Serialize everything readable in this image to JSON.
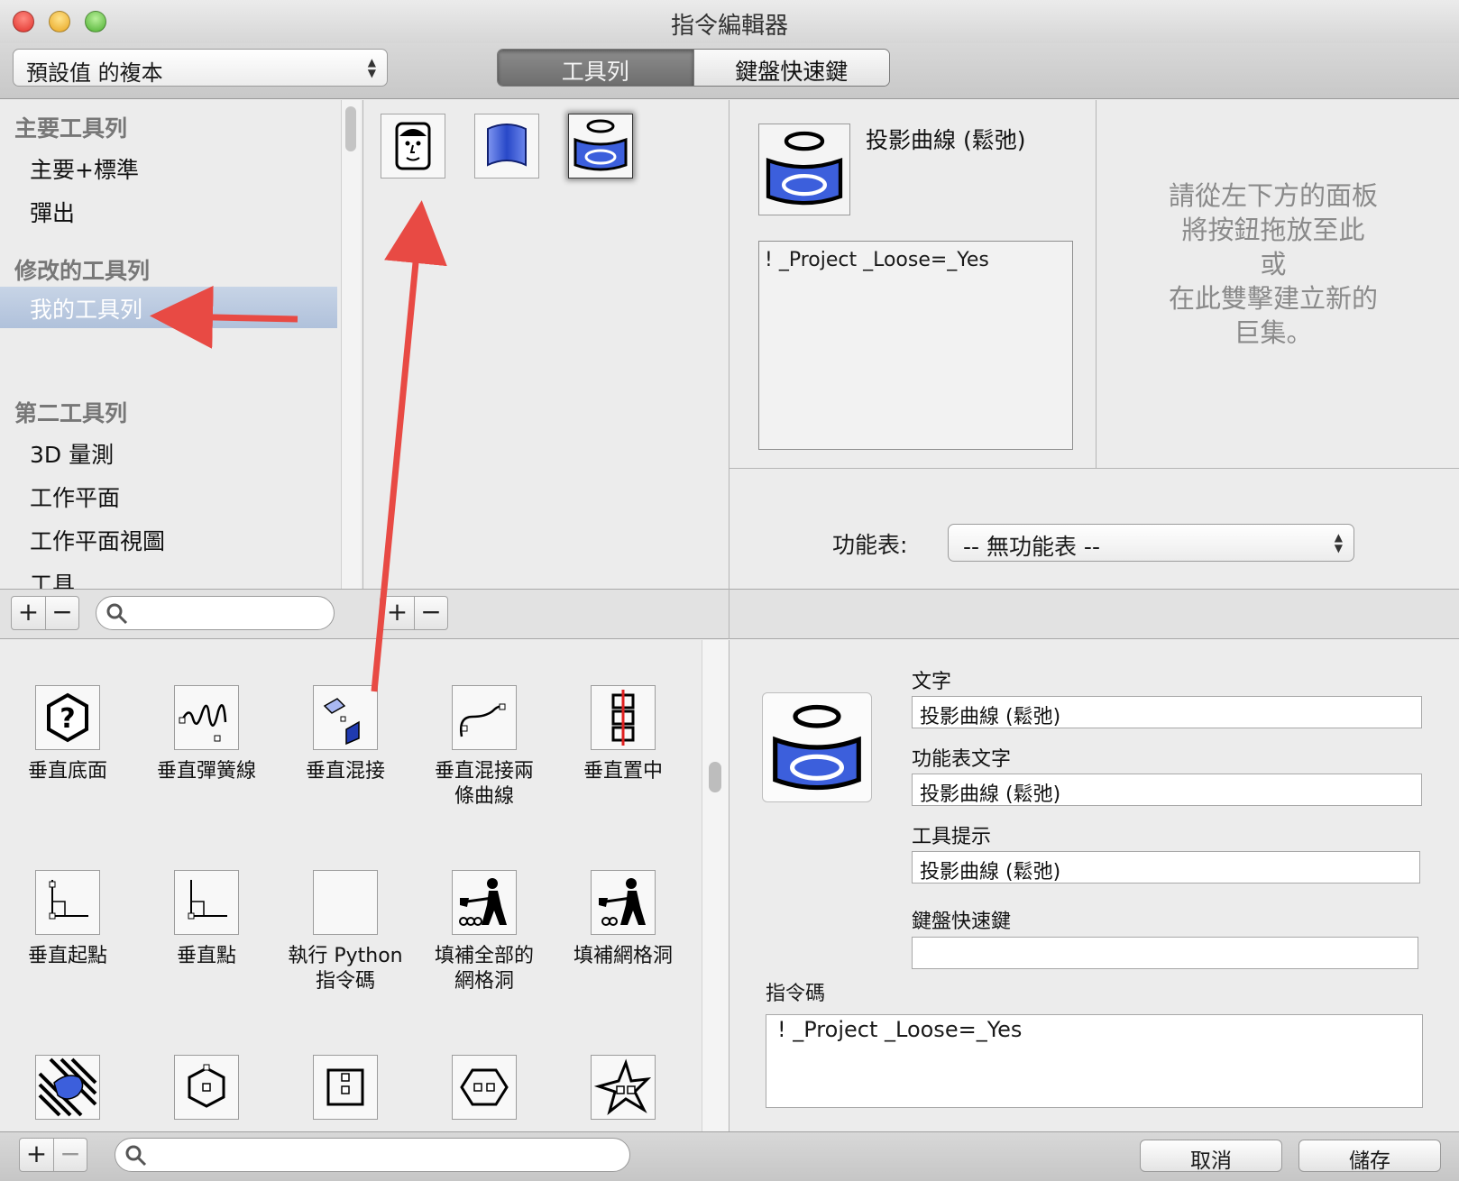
{
  "window": {
    "title": "指令編輯器"
  },
  "toolbar": {
    "preset_value": "預設值 的複本",
    "tabs": [
      {
        "label": "工具列",
        "active": true
      },
      {
        "label": "鍵盤快速鍵",
        "active": false
      }
    ]
  },
  "sidebar": {
    "groups": [
      {
        "label": "主要工具列",
        "items": [
          "主要+標準",
          "彈出"
        ]
      },
      {
        "label": "修改的工具列",
        "items": [
          "我的工具列"
        ]
      },
      {
        "label": "第二工具列",
        "items": [
          "3D 量測",
          "工作平面",
          "工作平面視圖",
          "工具"
        ]
      }
    ],
    "selected": "我的工具列"
  },
  "toolbar_buttons": [
    {
      "icon": "face-icon"
    },
    {
      "icon": "blue-surface-icon"
    },
    {
      "icon": "project-curve-icon",
      "selected": true
    }
  ],
  "properties": {
    "command_name": "投影曲線 (鬆弛)",
    "macro": "! _Project _Loose=_Yes",
    "hint_lines": [
      "請從左下方的面板",
      "將按鈕拖放至此",
      "或",
      "在此雙擊建立新的",
      "巨集。"
    ],
    "menu_label": "功能表:",
    "menu_value": "-- 無功能表 --"
  },
  "library": {
    "items": [
      {
        "label": "垂直底面",
        "icon": "hexagon-question-icon"
      },
      {
        "label": "垂直彈簧線",
        "icon": "spring-curve-icon"
      },
      {
        "label": "垂直混接",
        "icon": "blend-surface-icon"
      },
      {
        "label": "垂直混接兩\n條曲線",
        "icon": "blend-curves-icon"
      },
      {
        "label": "垂直置中",
        "icon": "center-align-icon"
      },
      {
        "label": "垂直起點",
        "icon": "perp-start-icon"
      },
      {
        "label": "垂直點",
        "icon": "perp-point-icon"
      },
      {
        "label": "執行 Python\n指令碼",
        "icon": "blank-icon"
      },
      {
        "label": "填補全部的\n網格洞",
        "icon": "shovel-man-all-icon"
      },
      {
        "label": "填補網格洞",
        "icon": "shovel-man-icon"
      },
      {
        "label": "",
        "icon": "hatched-lizard-icon"
      },
      {
        "label": "",
        "icon": "hexagon-point-icon"
      },
      {
        "label": "",
        "icon": "square-points-icon"
      },
      {
        "label": "",
        "icon": "hexagon-points-icon"
      },
      {
        "label": "",
        "icon": "star-points-icon"
      }
    ]
  },
  "editor": {
    "text_label": "文字",
    "text_value": "投影曲線 (鬆弛)",
    "menu_text_label": "功能表文字",
    "menu_text_value": "投影曲線 (鬆弛)",
    "tooltip_label": "工具提示",
    "tooltip_value": "投影曲線 (鬆弛)",
    "shortcut_label": "鍵盤快速鍵",
    "shortcut_value": "",
    "code_label": "指令碼",
    "code_value": "! _Project _Loose=_Yes"
  },
  "buttons": {
    "cancel": "取消",
    "save": "儲存",
    "plus": "+",
    "minus": "−"
  },
  "colors": {
    "selection": "#b3c3dc",
    "arrow": "#e84a44",
    "icon_blue": "#3c5fdc"
  }
}
